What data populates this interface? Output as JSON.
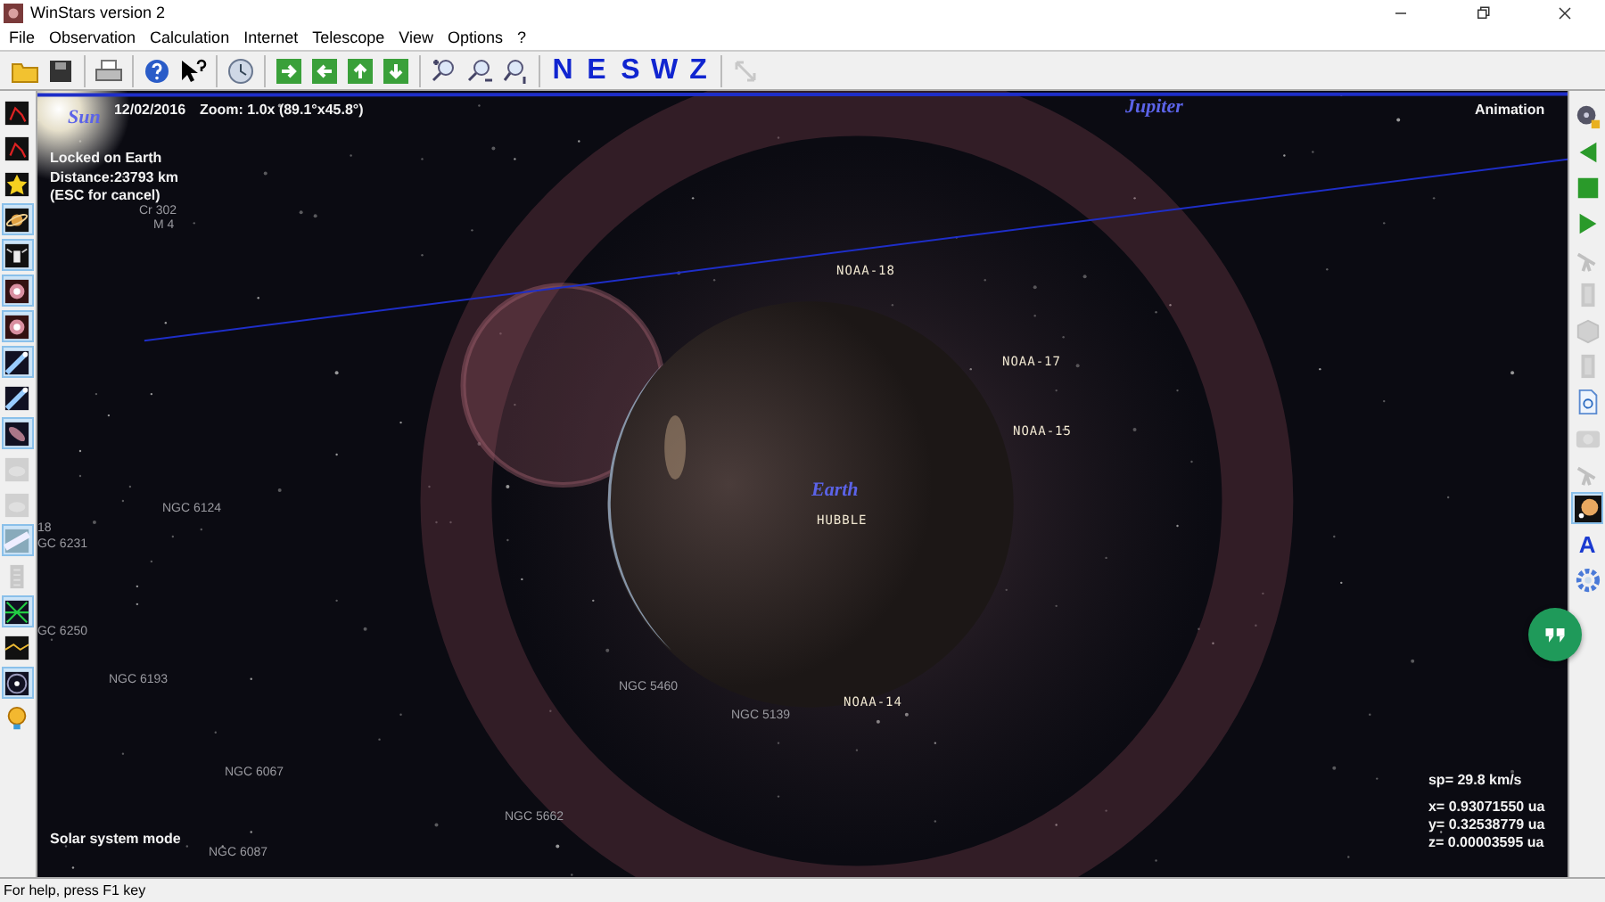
{
  "window": {
    "title": "WinStars version 2"
  },
  "menu": [
    "File",
    "Observation",
    "Calculation",
    "Internet",
    "Telescope",
    "View",
    "Options",
    "?"
  ],
  "toolbar": [
    {
      "kind": "folder"
    },
    {
      "kind": "disk"
    },
    {
      "kind": "separator"
    },
    {
      "kind": "printer"
    },
    {
      "kind": "separator"
    },
    {
      "kind": "help"
    },
    {
      "kind": "pointer-help"
    },
    {
      "kind": "separator"
    },
    {
      "kind": "clock"
    },
    {
      "kind": "separator"
    },
    {
      "kind": "arrow-right"
    },
    {
      "kind": "arrow-left"
    },
    {
      "kind": "arrow-up"
    },
    {
      "kind": "arrow-down"
    },
    {
      "kind": "separator"
    },
    {
      "kind": "zoom-in"
    },
    {
      "kind": "zoom-out"
    },
    {
      "kind": "zoom-reset"
    },
    {
      "kind": "separator"
    },
    {
      "kind": "letter",
      "label": "N"
    },
    {
      "kind": "letter",
      "label": "E"
    },
    {
      "kind": "letter",
      "label": "S"
    },
    {
      "kind": "letter",
      "label": "W"
    },
    {
      "kind": "letter",
      "label": "Z"
    },
    {
      "kind": "separator"
    },
    {
      "kind": "resize",
      "disabled": true
    }
  ],
  "left_toolbar": [
    {
      "kind": "constellation",
      "selected": false,
      "disabled": false
    },
    {
      "kind": "constellation",
      "selected": false,
      "disabled": false
    },
    {
      "kind": "star",
      "selected": false,
      "disabled": false
    },
    {
      "kind": "planet",
      "selected": true,
      "disabled": false
    },
    {
      "kind": "satellite",
      "selected": true,
      "disabled": false
    },
    {
      "kind": "nebula",
      "selected": true,
      "disabled": false
    },
    {
      "kind": "nebula",
      "selected": true,
      "disabled": false
    },
    {
      "kind": "comet",
      "selected": true,
      "disabled": false
    },
    {
      "kind": "comet",
      "selected": false,
      "disabled": false
    },
    {
      "kind": "galaxy",
      "selected": true,
      "disabled": false
    },
    {
      "kind": "cloud",
      "selected": false,
      "disabled": true
    },
    {
      "kind": "cloud",
      "selected": false,
      "disabled": true
    },
    {
      "kind": "milky-way",
      "selected": true,
      "disabled": false
    },
    {
      "kind": "ruler",
      "selected": false,
      "disabled": true
    },
    {
      "kind": "grid",
      "selected": true,
      "disabled": false
    },
    {
      "kind": "horizon",
      "selected": false,
      "disabled": false
    },
    {
      "kind": "orbit",
      "selected": true,
      "disabled": false
    },
    {
      "kind": "bulb",
      "selected": false,
      "disabled": false
    }
  ],
  "right_toolbar": [
    {
      "kind": "film",
      "selected": false,
      "disabled": false
    },
    {
      "kind": "play-back",
      "selected": false,
      "disabled": false
    },
    {
      "kind": "stop",
      "selected": false,
      "disabled": false
    },
    {
      "kind": "play",
      "selected": false,
      "disabled": false
    },
    {
      "kind": "telescope",
      "selected": false,
      "disabled": true
    },
    {
      "kind": "panel",
      "selected": false,
      "disabled": true
    },
    {
      "kind": "cube",
      "selected": false,
      "disabled": true
    },
    {
      "kind": "panel",
      "selected": false,
      "disabled": true
    },
    {
      "kind": "document",
      "selected": false,
      "disabled": false
    },
    {
      "kind": "camera",
      "selected": false,
      "disabled": true
    },
    {
      "kind": "telescope",
      "selected": false,
      "disabled": true
    },
    {
      "kind": "planet-view",
      "selected": true,
      "disabled": false
    },
    {
      "kind": "letter",
      "label": "A",
      "selected": false,
      "disabled": false
    },
    {
      "kind": "gear",
      "selected": false,
      "disabled": false
    }
  ],
  "sky": {
    "labels": [
      {
        "kind": "planet",
        "text": "Sun"
      },
      {
        "kind": "info",
        "text": "12/02/2016"
      },
      {
        "kind": "info",
        "text": "Zoom: 1.0x (89.1°x45.8°)"
      },
      {
        "kind": "planet",
        "text": "Jupiter"
      },
      {
        "kind": "info",
        "text": "Animation"
      },
      {
        "kind": "info",
        "text": "Locked on Earth"
      },
      {
        "kind": "info",
        "text": "Distance:23793 km"
      },
      {
        "kind": "info",
        "text": "(ESC for cancel)"
      },
      {
        "kind": "object",
        "text": "Cr 302"
      },
      {
        "kind": "object",
        "text": "M  4"
      },
      {
        "kind": "satellite",
        "text": "NOAA-18"
      },
      {
        "kind": "satellite",
        "text": "NOAA-17"
      },
      {
        "kind": "satellite",
        "text": "NOAA-15"
      },
      {
        "kind": "planet",
        "text": "Earth"
      },
      {
        "kind": "satellite",
        "text": "HUBBLE"
      },
      {
        "kind": "object",
        "text": "NGC 6124"
      },
      {
        "kind": "object",
        "text": "18"
      },
      {
        "kind": "object",
        "text": "GC 6231"
      },
      {
        "kind": "object",
        "text": "GC 6250"
      },
      {
        "kind": "object",
        "text": "NGC 6193"
      },
      {
        "kind": "object",
        "text": "NGC 5460"
      },
      {
        "kind": "object",
        "text": "NGC 5139"
      },
      {
        "kind": "satellite",
        "text": "NOAA-14"
      },
      {
        "kind": "object",
        "text": "NGC 6067"
      },
      {
        "kind": "object",
        "text": "NGC 5662"
      },
      {
        "kind": "object",
        "text": "NGC 6087"
      },
      {
        "kind": "info",
        "text": "Solar system mode"
      },
      {
        "kind": "info",
        "text": "sp=  29.8 km/s"
      },
      {
        "kind": "info",
        "text": "x= 0.93071550 ua"
      },
      {
        "kind": "info",
        "text": "y= 0.32538779 ua"
      },
      {
        "kind": "info",
        "text": "z= 0.00003595 ua"
      }
    ]
  },
  "status_bar": {
    "text": "For help, press F1 key"
  }
}
